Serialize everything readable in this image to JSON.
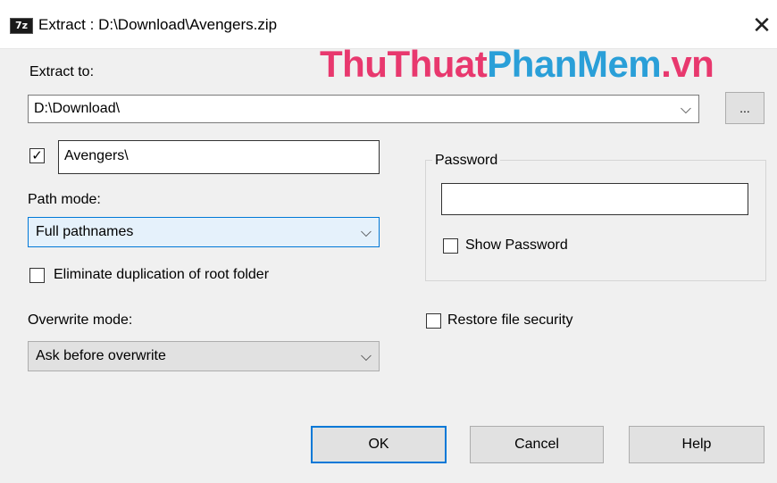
{
  "window": {
    "icon_label": "7z",
    "title": "Extract : D:\\Download\\Avengers.zip",
    "close_glyph": "✕"
  },
  "watermark": {
    "part1": "ThuThuat",
    "part2": "PhanMem",
    "part3": ".vn",
    "color1": "#e8386e",
    "color2": "#2a9fd8",
    "color3": "#e8386e"
  },
  "extract_to": {
    "label": "Extract to:",
    "value": "D:\\Download\\",
    "browse_label": "..."
  },
  "subfolder": {
    "checked": true,
    "value": "Avengers\\"
  },
  "path_mode": {
    "label": "Path mode:",
    "selected": "Full pathnames"
  },
  "eliminate_duplication": {
    "label": "Eliminate duplication of root folder",
    "checked": false
  },
  "overwrite_mode": {
    "label": "Overwrite mode:",
    "selected": "Ask before overwrite"
  },
  "password": {
    "group_label": "Password",
    "value": "",
    "show_label": "Show Password",
    "show_checked": false
  },
  "restore_security": {
    "label": "Restore file security",
    "checked": false
  },
  "buttons": {
    "ok": "OK",
    "cancel": "Cancel",
    "help": "Help"
  },
  "icons": {
    "check": "✓",
    "chevron": "⌵"
  },
  "colors": {
    "accent": "#0078d7"
  }
}
